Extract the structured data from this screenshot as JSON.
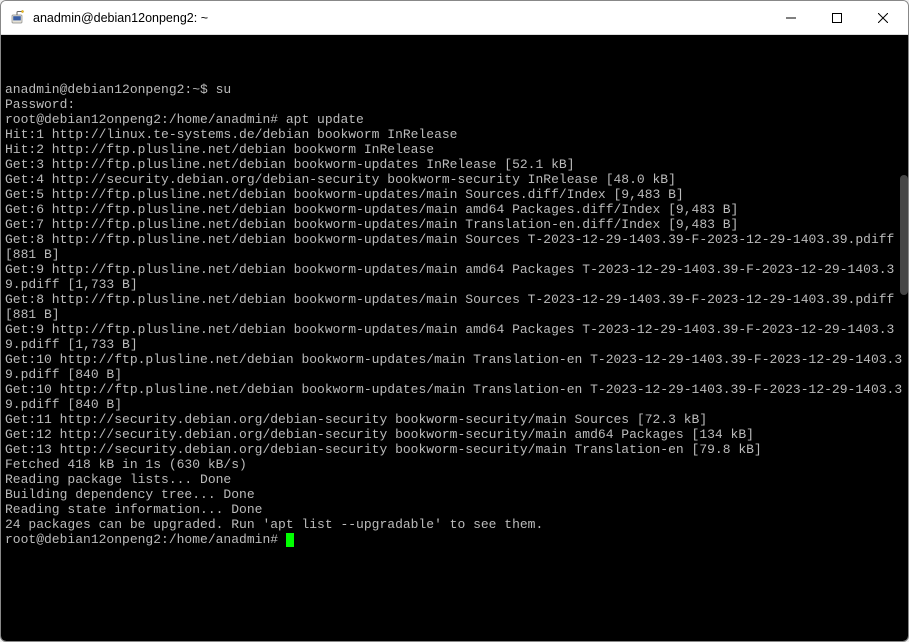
{
  "window": {
    "title": "anadmin@debian12onpeng2: ~"
  },
  "terminal": {
    "lines": [
      {
        "type": "prompt-user",
        "text": "anadmin@debian12onpeng2:~$ su"
      },
      {
        "type": "plain",
        "text": "Password:"
      },
      {
        "type": "prompt-root",
        "text": "root@debian12onpeng2:/home/anadmin# apt update"
      },
      {
        "type": "plain",
        "text": "Hit:1 http://linux.te-systems.de/debian bookworm InRelease"
      },
      {
        "type": "plain",
        "text": "Hit:2 http://ftp.plusline.net/debian bookworm InRelease"
      },
      {
        "type": "plain",
        "text": "Get:3 http://ftp.plusline.net/debian bookworm-updates InRelease [52.1 kB]"
      },
      {
        "type": "plain",
        "text": "Get:4 http://security.debian.org/debian-security bookworm-security InRelease [48.0 kB]"
      },
      {
        "type": "plain",
        "text": "Get:5 http://ftp.plusline.net/debian bookworm-updates/main Sources.diff/Index [9,483 B]"
      },
      {
        "type": "plain",
        "text": "Get:6 http://ftp.plusline.net/debian bookworm-updates/main amd64 Packages.diff/Index [9,483 B]"
      },
      {
        "type": "plain",
        "text": "Get:7 http://ftp.plusline.net/debian bookworm-updates/main Translation-en.diff/Index [9,483 B]"
      },
      {
        "type": "plain",
        "text": "Get:8 http://ftp.plusline.net/debian bookworm-updates/main Sources T-2023-12-29-1403.39-F-2023-12-29-1403.39.pdiff [881 B]"
      },
      {
        "type": "plain",
        "text": "Get:9 http://ftp.plusline.net/debian bookworm-updates/main amd64 Packages T-2023-12-29-1403.39-F-2023-12-29-1403.39.pdiff [1,733 B]"
      },
      {
        "type": "plain",
        "text": "Get:8 http://ftp.plusline.net/debian bookworm-updates/main Sources T-2023-12-29-1403.39-F-2023-12-29-1403.39.pdiff [881 B]"
      },
      {
        "type": "plain",
        "text": "Get:9 http://ftp.plusline.net/debian bookworm-updates/main amd64 Packages T-2023-12-29-1403.39-F-2023-12-29-1403.39.pdiff [1,733 B]"
      },
      {
        "type": "plain",
        "text": "Get:10 http://ftp.plusline.net/debian bookworm-updates/main Translation-en T-2023-12-29-1403.39-F-2023-12-29-1403.39.pdiff [840 B]"
      },
      {
        "type": "plain",
        "text": "Get:10 http://ftp.plusline.net/debian bookworm-updates/main Translation-en T-2023-12-29-1403.39-F-2023-12-29-1403.39.pdiff [840 B]"
      },
      {
        "type": "plain",
        "text": "Get:11 http://security.debian.org/debian-security bookworm-security/main Sources [72.3 kB]"
      },
      {
        "type": "plain",
        "text": "Get:12 http://security.debian.org/debian-security bookworm-security/main amd64 Packages [134 kB]"
      },
      {
        "type": "plain",
        "text": "Get:13 http://security.debian.org/debian-security bookworm-security/main Translation-en [79.8 kB]"
      },
      {
        "type": "plain",
        "text": "Fetched 418 kB in 1s (630 kB/s)"
      },
      {
        "type": "plain",
        "text": "Reading package lists... Done"
      },
      {
        "type": "plain",
        "text": "Building dependency tree... Done"
      },
      {
        "type": "plain",
        "text": "Reading state information... Done"
      },
      {
        "type": "plain",
        "text": "24 packages can be upgraded. Run 'apt list --upgradable' to see them."
      },
      {
        "type": "prompt-cursor",
        "text": "root@debian12onpeng2:/home/anadmin# "
      }
    ]
  }
}
